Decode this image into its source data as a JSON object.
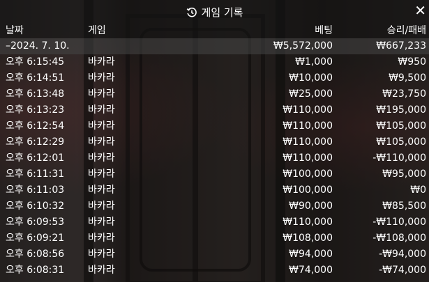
{
  "title": "게임 기록",
  "header": {
    "date": "날짜",
    "game": "게임",
    "bet": "베팅",
    "result": "승리/패배"
  },
  "summary": {
    "date": "–2024. 7. 10.",
    "bet": "₩5,572,000",
    "result": "₩667,233"
  },
  "rows": [
    {
      "time": "오후 6:15:45",
      "game": "바카라",
      "bet": "₩1,000",
      "result": "₩950"
    },
    {
      "time": "오후 6:14:51",
      "game": "바카라",
      "bet": "₩10,000",
      "result": "₩9,500"
    },
    {
      "time": "오후 6:13:48",
      "game": "바카라",
      "bet": "₩25,000",
      "result": "₩23,750"
    },
    {
      "time": "오후 6:13:23",
      "game": "바카라",
      "bet": "₩110,000",
      "result": "₩195,000"
    },
    {
      "time": "오후 6:12:54",
      "game": "바카라",
      "bet": "₩110,000",
      "result": "₩105,000"
    },
    {
      "time": "오후 6:12:29",
      "game": "바카라",
      "bet": "₩110,000",
      "result": "₩105,000"
    },
    {
      "time": "오후 6:12:01",
      "game": "바카라",
      "bet": "₩110,000",
      "result": "-₩110,000"
    },
    {
      "time": "오후 6:11:31",
      "game": "바카라",
      "bet": "₩100,000",
      "result": "₩95,000"
    },
    {
      "time": "오후 6:11:03",
      "game": "바카라",
      "bet": "₩100,000",
      "result": "₩0"
    },
    {
      "time": "오후 6:10:32",
      "game": "바카라",
      "bet": "₩90,000",
      "result": "₩85,500"
    },
    {
      "time": "오후 6:09:53",
      "game": "바카라",
      "bet": "₩110,000",
      "result": "-₩110,000"
    },
    {
      "time": "오후 6:09:21",
      "game": "바카라",
      "bet": "₩108,000",
      "result": "-₩108,000"
    },
    {
      "time": "오후 6:08:56",
      "game": "바카라",
      "bet": "₩94,000",
      "result": "-₩94,000"
    },
    {
      "time": "오후 6:08:31",
      "game": "바카라",
      "bet": "₩74,000",
      "result": "-₩74,000"
    }
  ],
  "icons": {
    "title_icon": "history-icon",
    "close_icon": "close-icon"
  }
}
